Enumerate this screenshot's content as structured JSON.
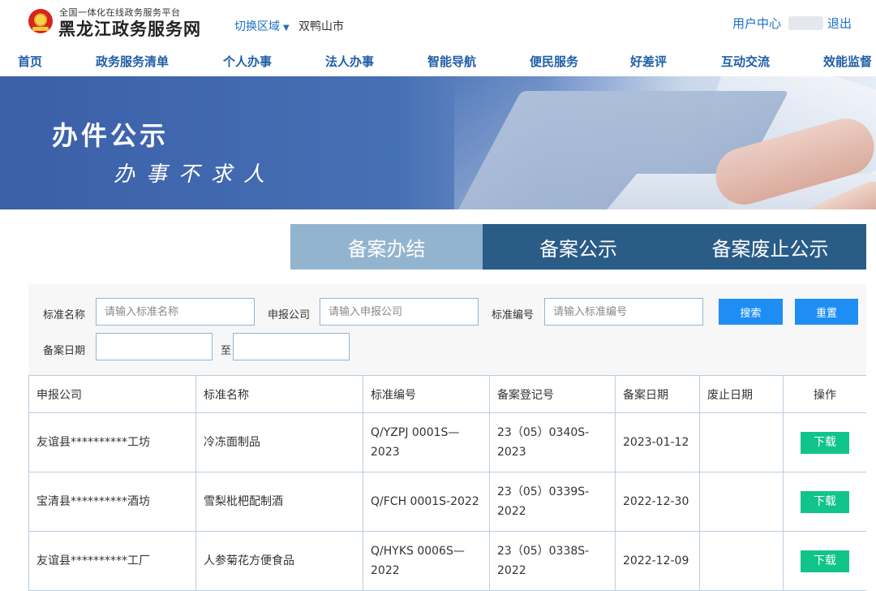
{
  "header": {
    "logo_sub": "全国一体化在线政务服务平台",
    "logo_main": "黑龙江政务服务网",
    "region_switch": "切换区域",
    "region_current": "双鸭山市",
    "user_center": "用户中心",
    "logout": "退出"
  },
  "nav": [
    "首页",
    "政务服务清单",
    "个人办事",
    "法人办事",
    "智能导航",
    "便民服务",
    "好差评",
    "互动交流",
    "效能监督"
  ],
  "banner": {
    "title": "办件公示",
    "slogan": "办事不求人"
  },
  "tabs": [
    "备案办结",
    "备案公示",
    "备案废止公示"
  ],
  "search": {
    "name_label": "标准名称",
    "name_placeholder": "请输入标准名称",
    "company_label": "申报公司",
    "company_placeholder": "请输入申报公司",
    "code_label": "标准编号",
    "code_placeholder": "请输入标准编号",
    "date_label": "备案日期",
    "date_sep": "至",
    "search_button": "搜索",
    "reset_button": "重置"
  },
  "table": {
    "headers": [
      "申报公司",
      "标准名称",
      "标准编号",
      "备案登记号",
      "备案日期",
      "废止日期",
      "操作"
    ],
    "rows": [
      {
        "company": "友谊县**********工坊",
        "name": "冷冻面制品",
        "code": "Q/YZPJ 0001S—2023",
        "reg": "23（05）0340S-2023",
        "date": "2023-01-12",
        "revoke": "",
        "action": "下载"
      },
      {
        "company": "宝清县**********酒坊",
        "name": "雪梨枇杷配制酒",
        "code": "Q/FCH 0001S-2022",
        "reg": "23（05）0339S-2022",
        "date": "2022-12-30",
        "revoke": "",
        "action": "下载"
      },
      {
        "company": "友谊县**********工厂",
        "name": "人参菊花方便食品",
        "code": "Q/HYKS 0006S—2022",
        "reg": "23（05）0338S-2022",
        "date": "2022-12-09",
        "revoke": "",
        "action": "下载"
      }
    ]
  },
  "colors": {
    "link": "#1a6fc4",
    "nav": "#1e5ea8",
    "tab_active": "#93b4cf",
    "tab": "#2a5c88",
    "button": "#1e8ef5",
    "download": "#10c48a"
  }
}
